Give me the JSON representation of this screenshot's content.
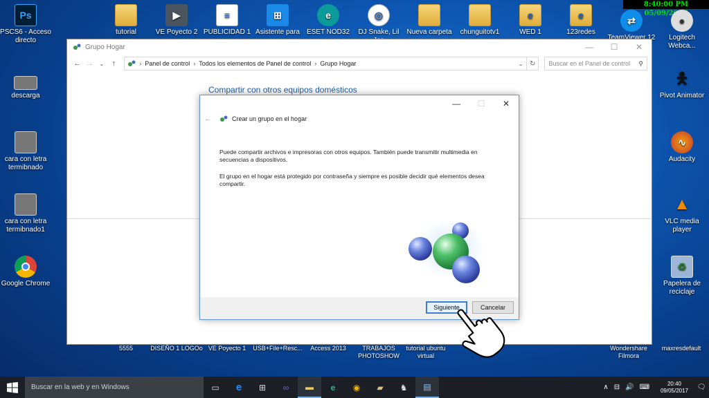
{
  "overlay_clock": "8:40:00 PM 05/09/2017",
  "desktop_top_icons": [
    {
      "label": "PSCS6 - Acceso directo",
      "icon": "photoshop-icon"
    },
    {
      "label": "tutorial",
      "icon": "video-icon"
    },
    {
      "label": "VE Poyecto 2",
      "icon": "file-icon"
    },
    {
      "label": "PUBLICIDAD 1",
      "icon": "document-icon"
    },
    {
      "label": "Asistente para",
      "icon": "windows-icon"
    },
    {
      "label": "ESET NOD32",
      "icon": "eset-icon"
    },
    {
      "label": "DJ Snake, Lil Jon",
      "icon": "media-icon"
    },
    {
      "label": "Nueva carpeta",
      "icon": "folder-icon"
    },
    {
      "label": "chunguitotv1",
      "icon": "folder-icon"
    },
    {
      "label": "WED 1",
      "icon": "folder-icon"
    },
    {
      "label": "123redes",
      "icon": "folder-icon"
    },
    {
      "label": "TeamViewer 12",
      "icon": "teamviewer-icon"
    },
    {
      "label": "Logitech Webca...",
      "icon": "webcam-icon"
    }
  ],
  "desktop_left_icons": [
    {
      "label": "descarga",
      "icon": "photo-icon"
    },
    {
      "label": "cara con letra termibnado",
      "icon": "photo-icon"
    },
    {
      "label": "cara con letra termibnado1",
      "icon": "photo-icon"
    },
    {
      "label": "Google Chrome",
      "icon": "chrome-icon"
    }
  ],
  "desktop_right_icons": [
    {
      "label": "Pivot Animator",
      "icon": "pivot-icon"
    },
    {
      "label": "Audacity",
      "icon": "audacity-icon"
    },
    {
      "label": "VLC media player",
      "icon": "vlc-icon"
    },
    {
      "label": "Papelera de reciclaje",
      "icon": "recycle-bin-icon"
    }
  ],
  "desktop_bottom_labels": [
    "5555",
    "DISEÑO 1 LOGOo",
    "VE Poyecto 1",
    "USB+File+Resc...",
    "Access 2013",
    "TRABAJOS PHOTOSHOW",
    "tutorial ubuntu virtual",
    "Wondershare Filmora",
    "maxresdefault"
  ],
  "window": {
    "title": "Grupo Hogar",
    "breadcrumb": [
      "Panel de control",
      "Todos los elementos de Panel de control",
      "Grupo Hogar"
    ],
    "search_placeholder": "Buscar en el Panel de control",
    "heading": "Compartir con otros equipos domésticos"
  },
  "dialog": {
    "title": "Crear un grupo en el hogar",
    "paragraph1": "Puede compartir archivos e impresoras con otros equipos. También puede transmitir multimedia en secuencias a dispositivos.",
    "paragraph2": "El grupo en el hogar está protegido por contraseña y siempre es posible decidir qué elementos desea compartir.",
    "next_label": "Siguiente",
    "cancel_label": "Cancelar"
  },
  "taskbar": {
    "search_placeholder": "Buscar en la web y en Windows",
    "time": "20:40",
    "date": "09/05/2017"
  }
}
